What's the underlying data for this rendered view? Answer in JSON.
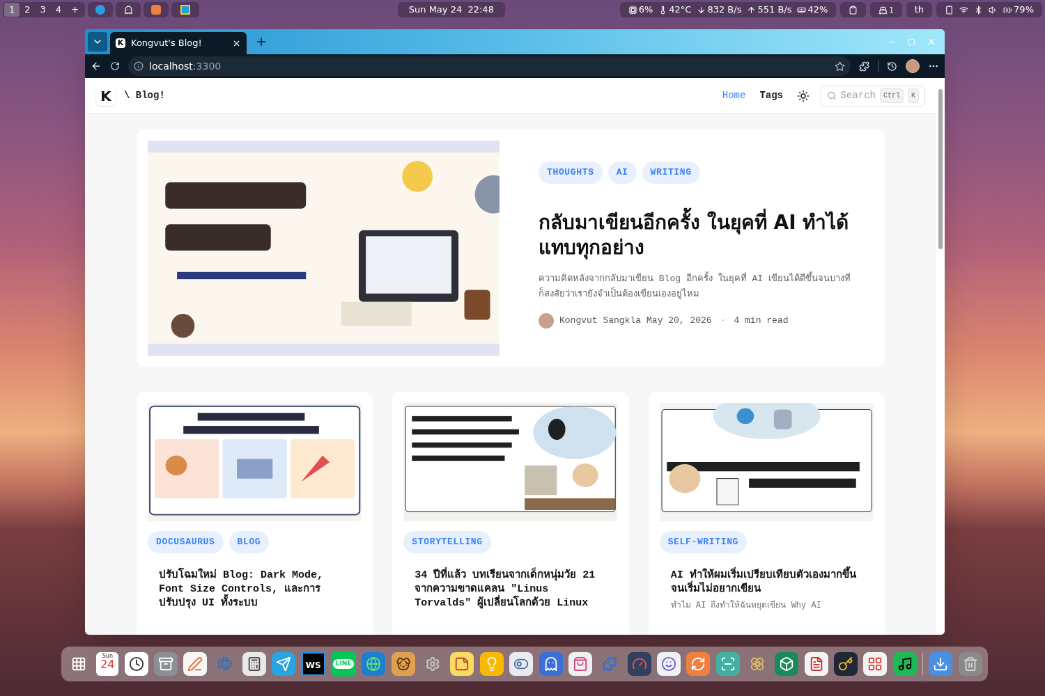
{
  "top_bar": {
    "workspaces": [
      {
        "label": "1",
        "selected": true
      },
      {
        "label": "2",
        "selected": false
      },
      {
        "label": "3",
        "selected": false
      },
      {
        "label": "4",
        "selected": false
      },
      {
        "label": "+",
        "selected": false
      }
    ],
    "clock": "Sun May 24  22:48",
    "status": [
      {
        "kind": "cpu",
        "text": "6%"
      },
      {
        "kind": "temp",
        "text": "42°C"
      },
      {
        "kind": "down",
        "text": "832 B/s"
      },
      {
        "kind": "up",
        "text": "551 B/s"
      },
      {
        "kind": "memory",
        "text": "42%"
      },
      {
        "kind": "clipboard"
      },
      {
        "kind": "docker",
        "text": "1"
      },
      {
        "kind": "layout",
        "text": "th"
      },
      {
        "kind": "tray"
      },
      {
        "kind": "battery",
        "text": "79%"
      }
    ]
  },
  "browser": {
    "tab": {
      "favicon": "K",
      "title": "Kongvut's Blog!",
      "selected": true
    },
    "url": {
      "host": "localhost",
      "port": ":3300"
    }
  },
  "blog_header": {
    "logo": "K",
    "breadcrumb": "\\ Blog!",
    "nav": [
      {
        "label": "Home",
        "selected": true
      },
      {
        "label": "Tags",
        "selected": false
      }
    ],
    "search": {
      "placeholder": "Search",
      "keys": [
        "Ctrl",
        "K"
      ]
    }
  },
  "hero": {
    "tags": [
      "THOUGHTS",
      "AI",
      "WRITING"
    ],
    "title": "กลับมาเขียนอีกครั้ง ในยุคที่ AI ทำได้แทบทุกอย่าง",
    "excerpt": "ความคิดหลังจากกลับมาเขียน Blog อีกครั้ง ในยุคที่ AI เขียนได้ดีขึ้นจนบางทีก็สงสัยว่าเรายังจำเป็นต้องเขียนเองอยู่ไหม",
    "author": "Kongvut Sangkla",
    "date": "May 20, 2026",
    "separator": "·",
    "read_time": "4 min read"
  },
  "cards": [
    {
      "tags": [
        "DOCUSAURUS",
        "BLOG"
      ],
      "title": "ปรับโฉมใหม่ Blog: Dark Mode, Font Size Controls, และการปรับปรุง UI ทั้งระบบ"
    },
    {
      "tags": [
        "STORYTELLING"
      ],
      "title": "34 ปีที่แล้ว บทเรียนจากเด็กหนุ่มวัย 21 จากความขาดแคลน \"Linus Torvalds\" ผู้เปลี่ยนโลกด้วย Linux"
    },
    {
      "tags": [
        "SELF-WRITING"
      ],
      "title": "AI ทำให้ผมเริ่มเปรียบเทียบตัวเองมากขึ้น จนเริ่มไม่อยากเขียน",
      "excerpt": "ทำไม AI ถึงทำให้ฉันหยุดเขียน Why AI"
    }
  ],
  "dock": {
    "calendar": {
      "weekday": "Sun",
      "day": "24"
    },
    "ws_label": "WS",
    "line_label": "LINE"
  }
}
